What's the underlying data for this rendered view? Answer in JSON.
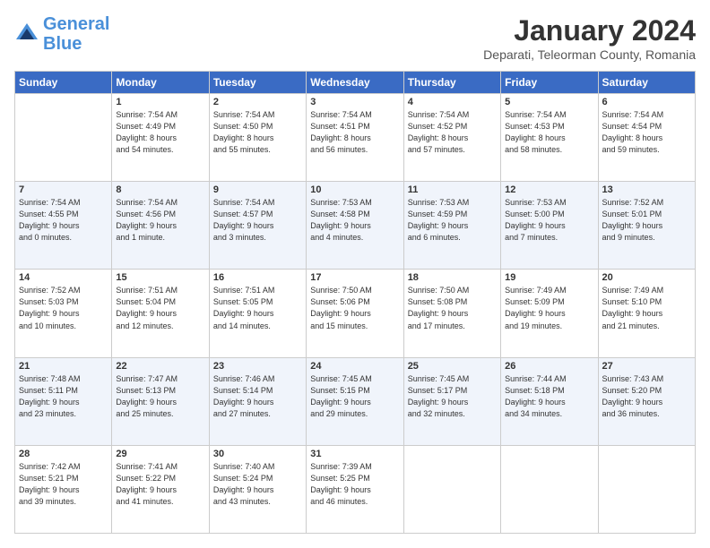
{
  "header": {
    "logo_line1": "General",
    "logo_line2": "Blue",
    "month_title": "January 2024",
    "location": "Deparati, Teleorman County, Romania"
  },
  "weekdays": [
    "Sunday",
    "Monday",
    "Tuesday",
    "Wednesday",
    "Thursday",
    "Friday",
    "Saturday"
  ],
  "weeks": [
    [
      {
        "day": "",
        "info": ""
      },
      {
        "day": "1",
        "info": "Sunrise: 7:54 AM\nSunset: 4:49 PM\nDaylight: 8 hours\nand 54 minutes."
      },
      {
        "day": "2",
        "info": "Sunrise: 7:54 AM\nSunset: 4:50 PM\nDaylight: 8 hours\nand 55 minutes."
      },
      {
        "day": "3",
        "info": "Sunrise: 7:54 AM\nSunset: 4:51 PM\nDaylight: 8 hours\nand 56 minutes."
      },
      {
        "day": "4",
        "info": "Sunrise: 7:54 AM\nSunset: 4:52 PM\nDaylight: 8 hours\nand 57 minutes."
      },
      {
        "day": "5",
        "info": "Sunrise: 7:54 AM\nSunset: 4:53 PM\nDaylight: 8 hours\nand 58 minutes."
      },
      {
        "day": "6",
        "info": "Sunrise: 7:54 AM\nSunset: 4:54 PM\nDaylight: 8 hours\nand 59 minutes."
      }
    ],
    [
      {
        "day": "7",
        "info": "Sunrise: 7:54 AM\nSunset: 4:55 PM\nDaylight: 9 hours\nand 0 minutes."
      },
      {
        "day": "8",
        "info": "Sunrise: 7:54 AM\nSunset: 4:56 PM\nDaylight: 9 hours\nand 1 minute."
      },
      {
        "day": "9",
        "info": "Sunrise: 7:54 AM\nSunset: 4:57 PM\nDaylight: 9 hours\nand 3 minutes."
      },
      {
        "day": "10",
        "info": "Sunrise: 7:53 AM\nSunset: 4:58 PM\nDaylight: 9 hours\nand 4 minutes."
      },
      {
        "day": "11",
        "info": "Sunrise: 7:53 AM\nSunset: 4:59 PM\nDaylight: 9 hours\nand 6 minutes."
      },
      {
        "day": "12",
        "info": "Sunrise: 7:53 AM\nSunset: 5:00 PM\nDaylight: 9 hours\nand 7 minutes."
      },
      {
        "day": "13",
        "info": "Sunrise: 7:52 AM\nSunset: 5:01 PM\nDaylight: 9 hours\nand 9 minutes."
      }
    ],
    [
      {
        "day": "14",
        "info": "Sunrise: 7:52 AM\nSunset: 5:03 PM\nDaylight: 9 hours\nand 10 minutes."
      },
      {
        "day": "15",
        "info": "Sunrise: 7:51 AM\nSunset: 5:04 PM\nDaylight: 9 hours\nand 12 minutes."
      },
      {
        "day": "16",
        "info": "Sunrise: 7:51 AM\nSunset: 5:05 PM\nDaylight: 9 hours\nand 14 minutes."
      },
      {
        "day": "17",
        "info": "Sunrise: 7:50 AM\nSunset: 5:06 PM\nDaylight: 9 hours\nand 15 minutes."
      },
      {
        "day": "18",
        "info": "Sunrise: 7:50 AM\nSunset: 5:08 PM\nDaylight: 9 hours\nand 17 minutes."
      },
      {
        "day": "19",
        "info": "Sunrise: 7:49 AM\nSunset: 5:09 PM\nDaylight: 9 hours\nand 19 minutes."
      },
      {
        "day": "20",
        "info": "Sunrise: 7:49 AM\nSunset: 5:10 PM\nDaylight: 9 hours\nand 21 minutes."
      }
    ],
    [
      {
        "day": "21",
        "info": "Sunrise: 7:48 AM\nSunset: 5:11 PM\nDaylight: 9 hours\nand 23 minutes."
      },
      {
        "day": "22",
        "info": "Sunrise: 7:47 AM\nSunset: 5:13 PM\nDaylight: 9 hours\nand 25 minutes."
      },
      {
        "day": "23",
        "info": "Sunrise: 7:46 AM\nSunset: 5:14 PM\nDaylight: 9 hours\nand 27 minutes."
      },
      {
        "day": "24",
        "info": "Sunrise: 7:45 AM\nSunset: 5:15 PM\nDaylight: 9 hours\nand 29 minutes."
      },
      {
        "day": "25",
        "info": "Sunrise: 7:45 AM\nSunset: 5:17 PM\nDaylight: 9 hours\nand 32 minutes."
      },
      {
        "day": "26",
        "info": "Sunrise: 7:44 AM\nSunset: 5:18 PM\nDaylight: 9 hours\nand 34 minutes."
      },
      {
        "day": "27",
        "info": "Sunrise: 7:43 AM\nSunset: 5:20 PM\nDaylight: 9 hours\nand 36 minutes."
      }
    ],
    [
      {
        "day": "28",
        "info": "Sunrise: 7:42 AM\nSunset: 5:21 PM\nDaylight: 9 hours\nand 39 minutes."
      },
      {
        "day": "29",
        "info": "Sunrise: 7:41 AM\nSunset: 5:22 PM\nDaylight: 9 hours\nand 41 minutes."
      },
      {
        "day": "30",
        "info": "Sunrise: 7:40 AM\nSunset: 5:24 PM\nDaylight: 9 hours\nand 43 minutes."
      },
      {
        "day": "31",
        "info": "Sunrise: 7:39 AM\nSunset: 5:25 PM\nDaylight: 9 hours\nand 46 minutes."
      },
      {
        "day": "",
        "info": ""
      },
      {
        "day": "",
        "info": ""
      },
      {
        "day": "",
        "info": ""
      }
    ]
  ]
}
